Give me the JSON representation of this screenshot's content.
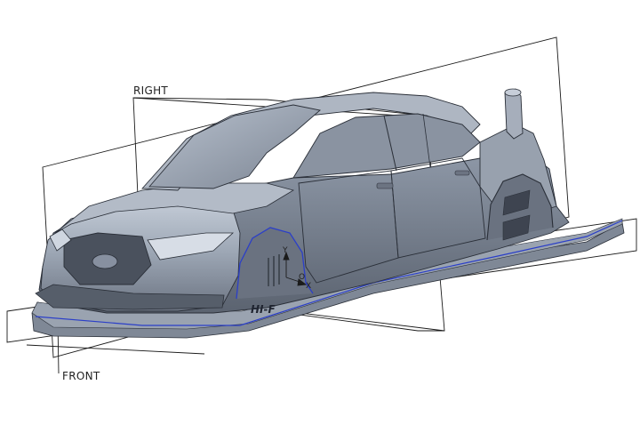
{
  "datum_planes": {
    "right_label": "RIGHT",
    "front_label": "FRONT"
  },
  "csys": {
    "y_label": "Y",
    "x_label": "X",
    "origin_label": "O"
  },
  "car": {
    "door_badge": "HI-F"
  },
  "colors": {
    "body_fill": "#9ca6b4",
    "body_dark": "#5e6674",
    "edge_line": "#2a2f38",
    "highlight": "#2b3fc8",
    "datum_line": "#1b1b1b"
  }
}
